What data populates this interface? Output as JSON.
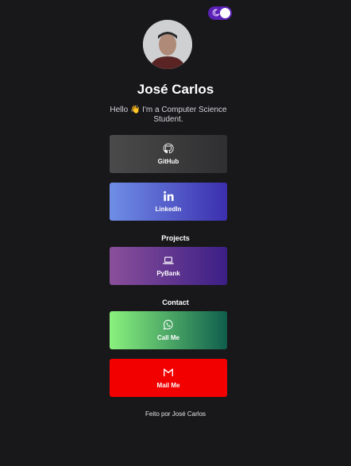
{
  "header": {
    "theme_toggle": {
      "state": "on",
      "icon": "moon-icon",
      "color": "#5b21b6"
    }
  },
  "profile": {
    "name": "José Carlos",
    "bio": "Hello 👋 I'm a Computer Science Student."
  },
  "links": {
    "github": {
      "label": "GitHub",
      "icon": "github-icon"
    },
    "linkedin": {
      "label": "LinkedIn",
      "icon": "linkedin-icon"
    }
  },
  "projects": {
    "title": "Projects",
    "items": [
      {
        "label": "PyBank",
        "icon": "laptop-icon"
      }
    ]
  },
  "contact": {
    "title": "Contact",
    "items": [
      {
        "label": "Call Me",
        "icon": "whatsapp-icon"
      },
      {
        "label": "Mail Me",
        "icon": "gmail-icon"
      }
    ]
  },
  "footer": {
    "text": "Feito por José Carlos"
  },
  "colors": {
    "background": "#18181b",
    "mail_red": "#f20000"
  }
}
